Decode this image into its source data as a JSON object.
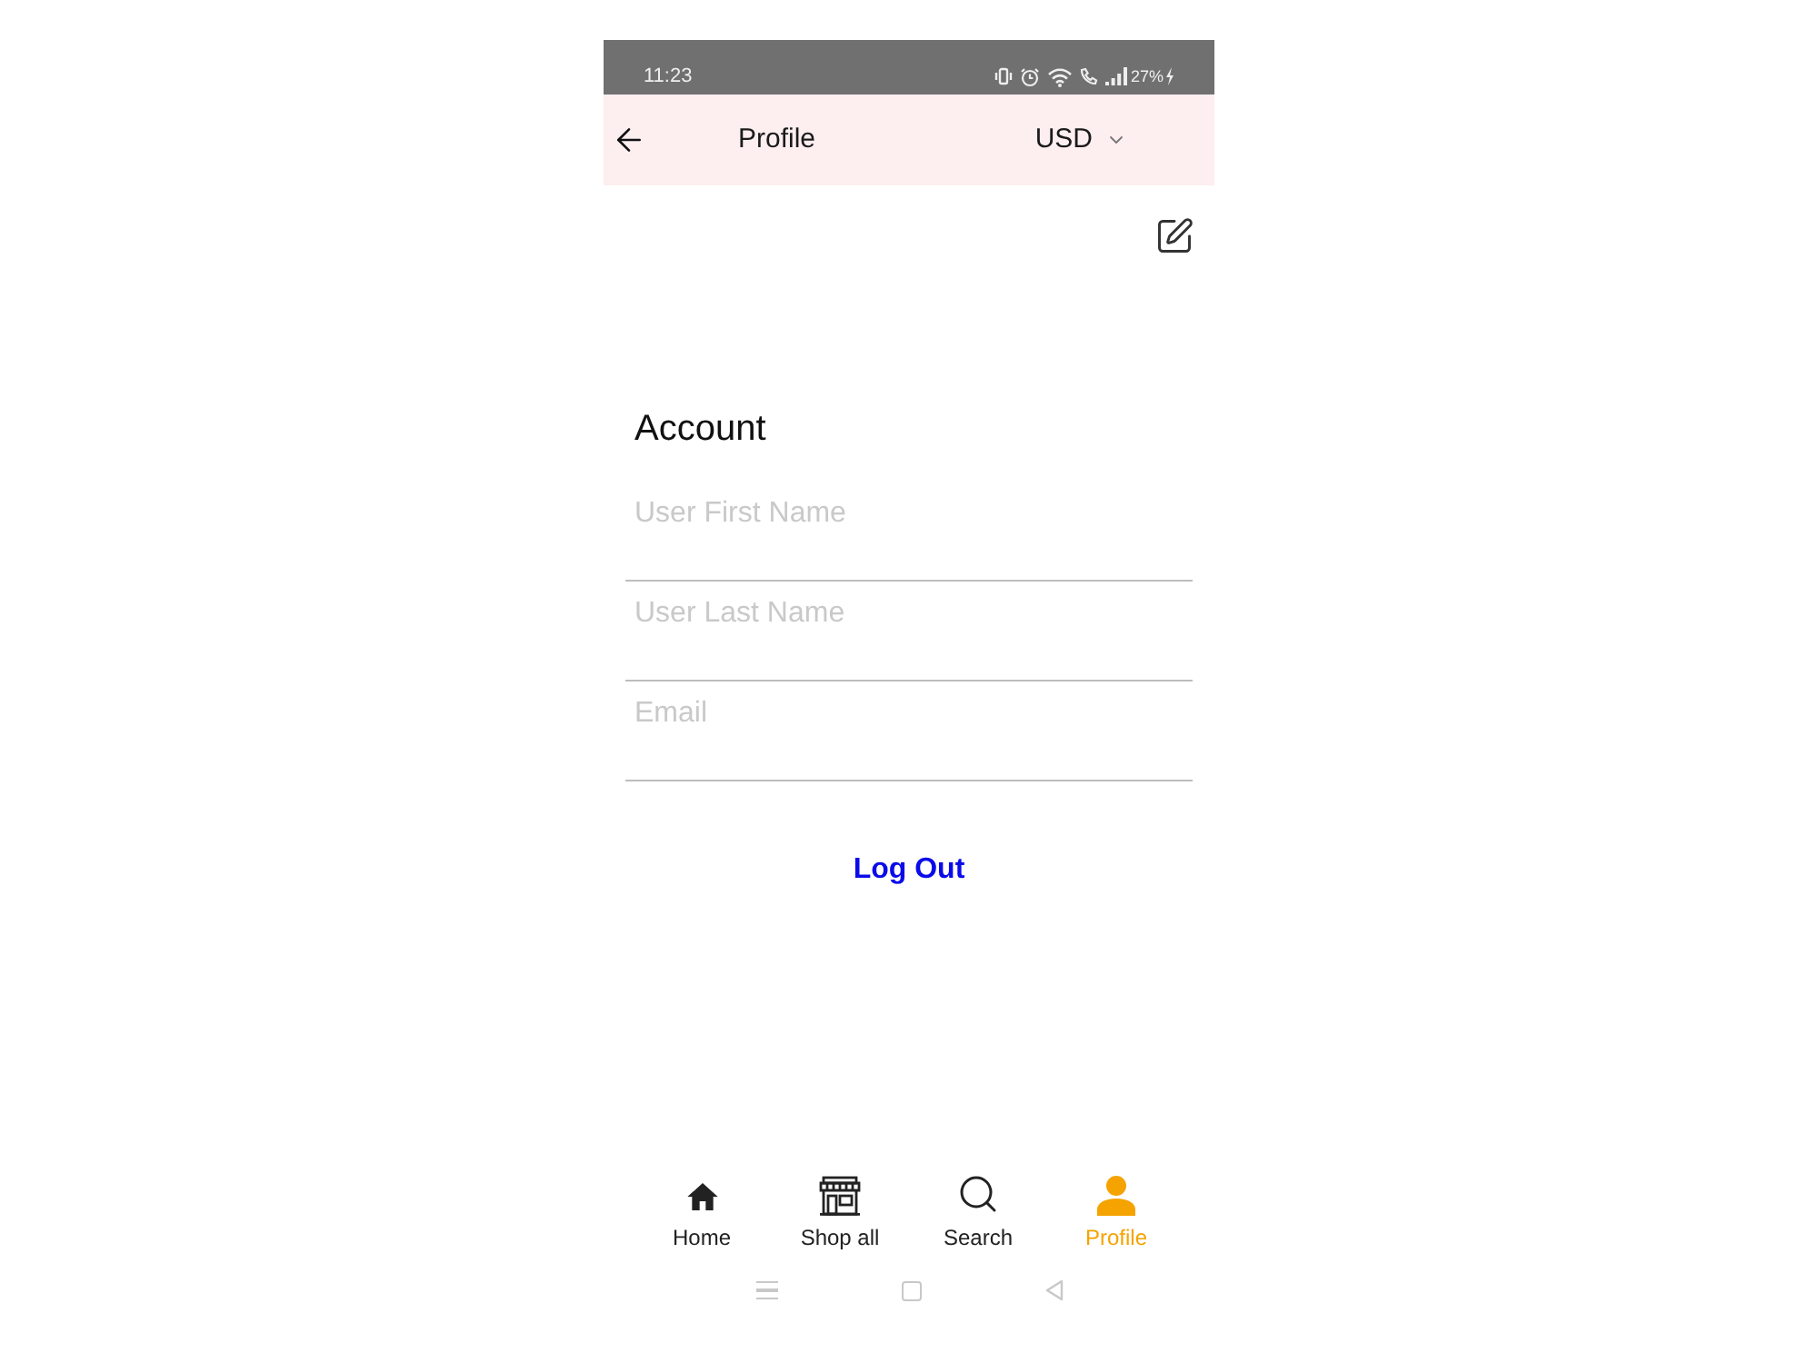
{
  "status_bar": {
    "time": "11:23",
    "battery": "27%"
  },
  "header": {
    "title": "Profile",
    "currency": "USD"
  },
  "account": {
    "title": "Account",
    "fields": [
      {
        "placeholder": "User First Name"
      },
      {
        "placeholder": "User Last Name"
      },
      {
        "placeholder": "Email"
      }
    ],
    "logout": "Log Out"
  },
  "bottom_nav": [
    {
      "label": "Home",
      "kind": "home",
      "selected": false
    },
    {
      "label": "Shop all",
      "kind": "shop",
      "selected": false
    },
    {
      "label": "Search",
      "kind": "search",
      "selected": false
    },
    {
      "label": "Profile",
      "kind": "profile",
      "selected": true
    }
  ]
}
